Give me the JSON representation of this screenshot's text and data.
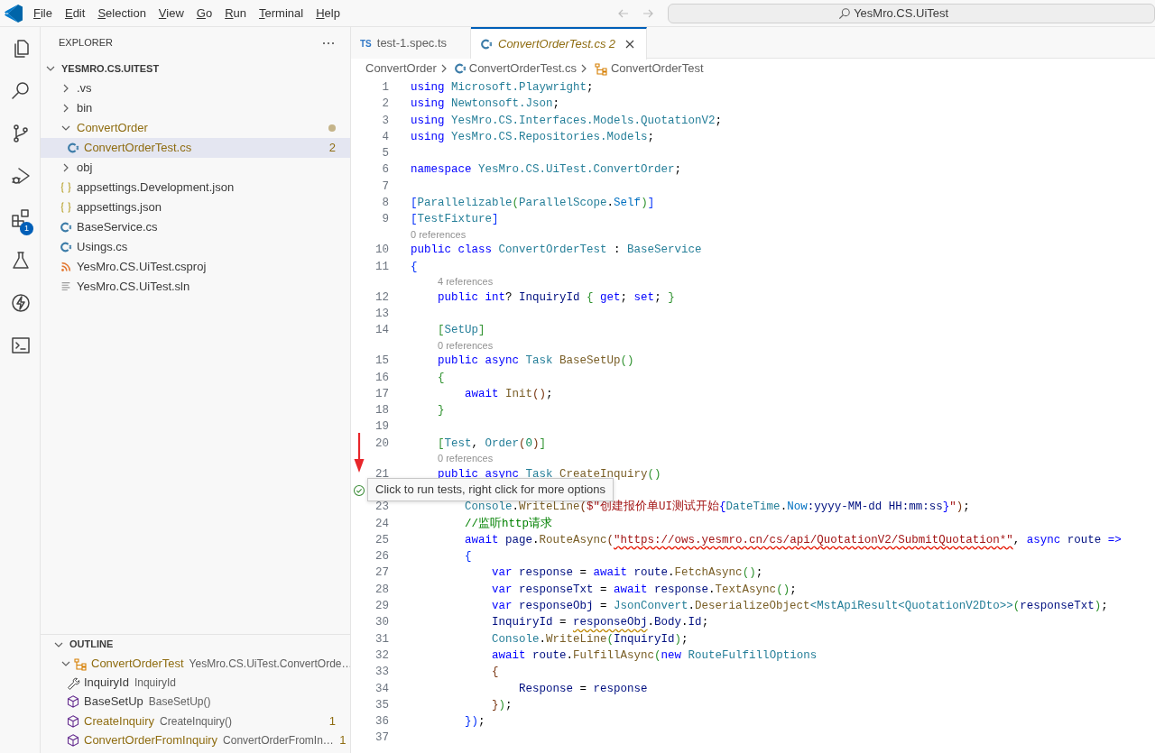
{
  "menubar": {
    "items": [
      "File",
      "Edit",
      "Selection",
      "View",
      "Go",
      "Run",
      "Terminal",
      "Help"
    ],
    "search": "YesMro.CS.UiTest"
  },
  "activity_bar": [
    {
      "kind": "files"
    },
    {
      "kind": "search"
    },
    {
      "kind": "source"
    },
    {
      "kind": "debug"
    },
    {
      "kind": "extensions",
      "badge": "1"
    },
    {
      "kind": "testing"
    },
    {
      "kind": "lightning"
    },
    {
      "kind": "terminal"
    }
  ],
  "explorer": {
    "title": "EXPLORER",
    "root": {
      "label": "YESMRO.CS.UITEST",
      "expanded": true
    },
    "items": [
      {
        "label": ".vs",
        "kind": "folder",
        "expanded": false,
        "selected": false,
        "warning": false
      },
      {
        "label": "bin",
        "kind": "folder",
        "expanded": false,
        "selected": false,
        "warning": false
      },
      {
        "label": "ConvertOrder",
        "kind": "folder",
        "expanded": true,
        "selected": false,
        "warning": true,
        "children": [
          {
            "label": "ConvertOrderTest.cs",
            "kind": "csharp",
            "selected": true,
            "warning": true,
            "badge": "2"
          }
        ]
      },
      {
        "label": "obj",
        "kind": "folder",
        "expanded": false,
        "selected": false,
        "warning": false
      },
      {
        "label": "appsettings.Development.json",
        "kind": "json",
        "selected": false,
        "warning": false
      },
      {
        "label": "appsettings.json",
        "kind": "json",
        "selected": false,
        "warning": false
      },
      {
        "label": "BaseService.cs",
        "kind": "csharp",
        "selected": false,
        "warning": false
      },
      {
        "label": "Usings.cs",
        "kind": "csharp",
        "selected": false,
        "warning": false
      },
      {
        "label": "YesMro.CS.UiTest.csproj",
        "kind": "project",
        "selected": false,
        "warning": false
      },
      {
        "label": "YesMro.CS.UiTest.sln",
        "kind": "solution",
        "selected": false,
        "warning": false
      }
    ]
  },
  "outline": {
    "title": "OUTLINE",
    "expanded": true,
    "items": [
      {
        "label": "ConvertOrderTest",
        "detail": "YesMro.CS.UiTest.ConvertOrde…",
        "kind": "class",
        "expanded": true,
        "warning": true,
        "children": [
          {
            "label": "InquiryId",
            "detail": "InquiryId",
            "kind": "property",
            "warning": false
          },
          {
            "label": "BaseSetUp",
            "detail": "BaseSetUp()",
            "kind": "method",
            "warning": false
          },
          {
            "label": "CreateInquiry",
            "detail": "CreateInquiry()",
            "kind": "method",
            "warning": true,
            "badge": "1"
          },
          {
            "label": "ConvertOrderFromInquiry",
            "detail": "ConvertOrderFromIn…",
            "kind": "method",
            "warning": true,
            "badge": "1"
          }
        ]
      }
    ]
  },
  "tabs": [
    {
      "label": "test-1.spec.ts",
      "icon_text": "TS",
      "kind": "typescript",
      "selected": false,
      "italic": false,
      "warning": false
    },
    {
      "label": "ConvertOrderTest.cs",
      "kind": "csharp",
      "selected": true,
      "italic": true,
      "warning": true,
      "badge": "2"
    }
  ],
  "breadcrumb": [
    {
      "label": "ConvertOrder",
      "kind": "folder"
    },
    {
      "label": "ConvertOrderTest.cs",
      "kind": "csharp"
    },
    {
      "label": "ConvertOrderTest",
      "kind": "class"
    }
  ],
  "tooltip": {
    "text": "Click to run tests, right click for more options"
  },
  "code": [
    {
      "kind": "code",
      "number": "1",
      "segments": [
        {
          "kind": "kw",
          "text": "using"
        },
        {
          "kind": "type",
          "text": " Microsoft.Playwright"
        },
        {
          "kind": "p",
          "text": ";"
        }
      ]
    },
    {
      "kind": "code",
      "number": "2",
      "segments": [
        {
          "kind": "kw",
          "text": "using"
        },
        {
          "kind": "type",
          "text": " Newtonsoft.Json"
        },
        {
          "kind": "p",
          "text": ";"
        }
      ]
    },
    {
      "kind": "code",
      "number": "3",
      "segments": [
        {
          "kind": "kw",
          "text": "using"
        },
        {
          "kind": "type",
          "text": " YesMro.CS.Interfaces.Models.QuotationV2"
        },
        {
          "kind": "p",
          "text": ";"
        }
      ]
    },
    {
      "kind": "code",
      "number": "4",
      "segments": [
        {
          "kind": "kw",
          "text": "using"
        },
        {
          "kind": "type",
          "text": " YesMro.CS.Repositories.Models"
        },
        {
          "kind": "p",
          "text": ";"
        }
      ]
    },
    {
      "kind": "code",
      "number": "5"
    },
    {
      "kind": "code",
      "number": "6",
      "segments": [
        {
          "kind": "kw",
          "text": "namespace"
        },
        {
          "kind": "type",
          "text": " YesMro.CS.UiTest.ConvertOrder"
        },
        {
          "kind": "p",
          "text": ";"
        }
      ]
    },
    {
      "kind": "code",
      "number": "7"
    },
    {
      "kind": "code",
      "number": "8",
      "segments": [
        {
          "kind": "b1",
          "text": "["
        },
        {
          "kind": "type",
          "text": "Parallelizable"
        },
        {
          "kind": "b2",
          "text": "("
        },
        {
          "kind": "type",
          "text": "ParallelScope"
        },
        {
          "kind": "p",
          "text": "."
        },
        {
          "kind": "const",
          "text": "Self"
        },
        {
          "kind": "b2",
          "text": ")"
        },
        {
          "kind": "b1",
          "text": "]"
        }
      ]
    },
    {
      "kind": "code",
      "number": "9",
      "segments": [
        {
          "kind": "b1",
          "text": "["
        },
        {
          "kind": "type",
          "text": "TestFixture"
        },
        {
          "kind": "b1",
          "text": "]"
        }
      ]
    },
    {
      "kind": "lens",
      "text": "0 references"
    },
    {
      "kind": "code",
      "number": "10",
      "segments": [
        {
          "kind": "kw",
          "text": "public class"
        },
        {
          "kind": "type",
          "text": " ConvertOrderTest"
        },
        {
          "kind": "p",
          "text": " : "
        },
        {
          "kind": "type",
          "text": "BaseService"
        }
      ]
    },
    {
      "kind": "code",
      "number": "11",
      "segments": [
        {
          "kind": "b1",
          "text": "{"
        }
      ]
    },
    {
      "kind": "lens",
      "text": "4 references"
    },
    {
      "kind": "code",
      "number": "12",
      "segments": [
        {
          "kind": "kw",
          "text": "    public int"
        },
        {
          "kind": "p",
          "text": "? "
        },
        {
          "kind": "var",
          "text": "InquiryId"
        },
        {
          "kind": "b2",
          "text": " {"
        },
        {
          "kind": "kw",
          "text": " get"
        },
        {
          "kind": "p",
          "text": "; "
        },
        {
          "kind": "kw",
          "text": "set"
        },
        {
          "kind": "p",
          "text": "; "
        },
        {
          "kind": "b2",
          "text": "}"
        }
      ]
    },
    {
      "kind": "code",
      "number": "13"
    },
    {
      "kind": "code",
      "number": "14",
      "segments": [
        {
          "kind": "b2",
          "text": "    ["
        },
        {
          "kind": "type",
          "text": "SetUp"
        },
        {
          "kind": "b2",
          "text": "]"
        }
      ]
    },
    {
      "kind": "lens",
      "text": "0 references"
    },
    {
      "kind": "code",
      "number": "15",
      "segments": [
        {
          "kind": "kw",
          "text": "    public async"
        },
        {
          "kind": "type",
          "text": " Task"
        },
        {
          "kind": "fn",
          "text": " BaseSetUp"
        },
        {
          "kind": "b2",
          "text": "()"
        }
      ]
    },
    {
      "kind": "code",
      "number": "16",
      "segments": [
        {
          "kind": "b2",
          "text": "    {"
        }
      ]
    },
    {
      "kind": "code",
      "number": "17",
      "segments": [
        {
          "kind": "kw",
          "text": "        await"
        },
        {
          "kind": "fn",
          "text": " Init"
        },
        {
          "kind": "b3",
          "text": "()"
        },
        {
          "kind": "p",
          "text": ";"
        }
      ]
    },
    {
      "kind": "code",
      "number": "18",
      "segments": [
        {
          "kind": "b2",
          "text": "    }"
        }
      ]
    },
    {
      "kind": "code",
      "number": "19"
    },
    {
      "kind": "code",
      "number": "20",
      "segments": [
        {
          "kind": "b2",
          "text": "    ["
        },
        {
          "kind": "type",
          "text": "Test"
        },
        {
          "kind": "p",
          "text": ", "
        },
        {
          "kind": "type",
          "text": "Order"
        },
        {
          "kind": "b3",
          "text": "("
        },
        {
          "kind": "num",
          "text": "0"
        },
        {
          "kind": "b3",
          "text": ")"
        },
        {
          "kind": "b2",
          "text": "]"
        }
      ]
    },
    {
      "kind": "lens",
      "text": "0 references"
    },
    {
      "kind": "code",
      "number": "21",
      "segments": [
        {
          "kind": "kw",
          "text": "    public async"
        },
        {
          "kind": "type",
          "text": " Task"
        },
        {
          "kind": "fn",
          "text": " CreateInquiry"
        },
        {
          "kind": "b2",
          "text": "()"
        }
      ]
    },
    {
      "kind": "covered",
      "passed": true
    },
    {
      "kind": "code",
      "number": "23",
      "segments": [
        {
          "kind": "type",
          "text": "        Console"
        },
        {
          "kind": "p",
          "text": "."
        },
        {
          "kind": "fn",
          "text": "WriteLine"
        },
        {
          "kind": "b3",
          "text": "("
        },
        {
          "kind": "str",
          "text": "$\"创建报价单UI测试开始"
        },
        {
          "kind": "kw",
          "text": "{"
        },
        {
          "kind": "type",
          "text": "DateTime"
        },
        {
          "kind": "p",
          "text": "."
        },
        {
          "kind": "const",
          "text": "Now"
        },
        {
          "kind": "var",
          "text": ":yyyy-MM-dd HH:mm:ss"
        },
        {
          "kind": "kw",
          "text": "}"
        },
        {
          "kind": "str",
          "text": "\""
        },
        {
          "kind": "b3",
          "text": ")"
        },
        {
          "kind": "p",
          "text": ";"
        }
      ]
    },
    {
      "kind": "code",
      "number": "24",
      "segments": [
        {
          "kind": "cmt",
          "text": "        //监听http请求"
        }
      ]
    },
    {
      "kind": "code",
      "number": "25",
      "segments": [
        {
          "kind": "kw",
          "text": "        await"
        },
        {
          "kind": "var",
          "text": " page"
        },
        {
          "kind": "p",
          "text": "."
        },
        {
          "kind": "fn",
          "text": "RouteAsync"
        },
        {
          "kind": "b3",
          "text": "("
        },
        {
          "kind": "strerror",
          "text": "\"https://ows.yesmro.cn/cs/api/QuotationV2/SubmitQuotation*\""
        },
        {
          "kind": "p",
          "text": ", "
        },
        {
          "kind": "kw",
          "text": "async"
        },
        {
          "kind": "var",
          "text": " route"
        },
        {
          "kind": "kw",
          "text": " =>"
        }
      ]
    },
    {
      "kind": "code",
      "number": "26",
      "segments": [
        {
          "kind": "b1",
          "text": "        {"
        }
      ]
    },
    {
      "kind": "code",
      "number": "27",
      "segments": [
        {
          "kind": "kw",
          "text": "            var"
        },
        {
          "kind": "var",
          "text": " response"
        },
        {
          "kind": "p",
          "text": " = "
        },
        {
          "kind": "kw",
          "text": "await"
        },
        {
          "kind": "var",
          "text": " route"
        },
        {
          "kind": "p",
          "text": "."
        },
        {
          "kind": "fn",
          "text": "FetchAsync"
        },
        {
          "kind": "b2",
          "text": "()"
        },
        {
          "kind": "p",
          "text": ";"
        }
      ]
    },
    {
      "kind": "code",
      "number": "28",
      "segments": [
        {
          "kind": "kw",
          "text": "            var"
        },
        {
          "kind": "var",
          "text": " responseTxt"
        },
        {
          "kind": "p",
          "text": " = "
        },
        {
          "kind": "kw",
          "text": "await"
        },
        {
          "kind": "var",
          "text": " response"
        },
        {
          "kind": "p",
          "text": "."
        },
        {
          "kind": "fn",
          "text": "TextAsync"
        },
        {
          "kind": "b2",
          "text": "()"
        },
        {
          "kind": "p",
          "text": ";"
        }
      ]
    },
    {
      "kind": "code",
      "number": "29",
      "segments": [
        {
          "kind": "kw",
          "text": "            var"
        },
        {
          "kind": "var",
          "text": " responseObj"
        },
        {
          "kind": "p",
          "text": " = "
        },
        {
          "kind": "type",
          "text": "JsonConvert"
        },
        {
          "kind": "p",
          "text": "."
        },
        {
          "kind": "fn",
          "text": "DeserializeObject"
        },
        {
          "kind": "type",
          "text": "<MstApiResult<QuotationV2Dto>>"
        },
        {
          "kind": "b2",
          "text": "("
        },
        {
          "kind": "var",
          "text": "responseTxt"
        },
        {
          "kind": "b2",
          "text": ")"
        },
        {
          "kind": "p",
          "text": ";"
        }
      ]
    },
    {
      "kind": "code",
      "number": "30",
      "segments": [
        {
          "kind": "var",
          "text": "            InquiryId"
        },
        {
          "kind": "p",
          "text": " = "
        },
        {
          "kind": "varwarning",
          "text": "responseObj"
        },
        {
          "kind": "p",
          "text": "."
        },
        {
          "kind": "var",
          "text": "Body"
        },
        {
          "kind": "p",
          "text": "."
        },
        {
          "kind": "var",
          "text": "Id"
        },
        {
          "kind": "p",
          "text": ";"
        }
      ]
    },
    {
      "kind": "code",
      "number": "31",
      "segments": [
        {
          "kind": "type",
          "text": "            Console"
        },
        {
          "kind": "p",
          "text": "."
        },
        {
          "kind": "fn",
          "text": "WriteLine"
        },
        {
          "kind": "b2",
          "text": "("
        },
        {
          "kind": "var",
          "text": "InquiryId"
        },
        {
          "kind": "b2",
          "text": ")"
        },
        {
          "kind": "p",
          "text": ";"
        }
      ]
    },
    {
      "kind": "code",
      "number": "32",
      "segments": [
        {
          "kind": "kw",
          "text": "            await"
        },
        {
          "kind": "var",
          "text": " route"
        },
        {
          "kind": "p",
          "text": "."
        },
        {
          "kind": "fn",
          "text": "FulfillAsync"
        },
        {
          "kind": "b2",
          "text": "("
        },
        {
          "kind": "kw",
          "text": "new"
        },
        {
          "kind": "type",
          "text": " RouteFulfillOptions"
        }
      ]
    },
    {
      "kind": "code",
      "number": "33",
      "segments": [
        {
          "kind": "b3",
          "text": "            {"
        }
      ]
    },
    {
      "kind": "code",
      "number": "34",
      "segments": [
        {
          "kind": "var",
          "text": "                Response"
        },
        {
          "kind": "p",
          "text": " = "
        },
        {
          "kind": "var",
          "text": "response"
        }
      ]
    },
    {
      "kind": "code",
      "number": "35",
      "segments": [
        {
          "kind": "b3",
          "text": "            }"
        },
        {
          "kind": "b2",
          "text": ")"
        },
        {
          "kind": "p",
          "text": ";"
        }
      ]
    },
    {
      "kind": "code",
      "number": "36",
      "segments": [
        {
          "kind": "b1",
          "text": "        })"
        },
        {
          "kind": "p",
          "text": ";"
        }
      ]
    },
    {
      "kind": "code",
      "number": "37"
    }
  ]
}
